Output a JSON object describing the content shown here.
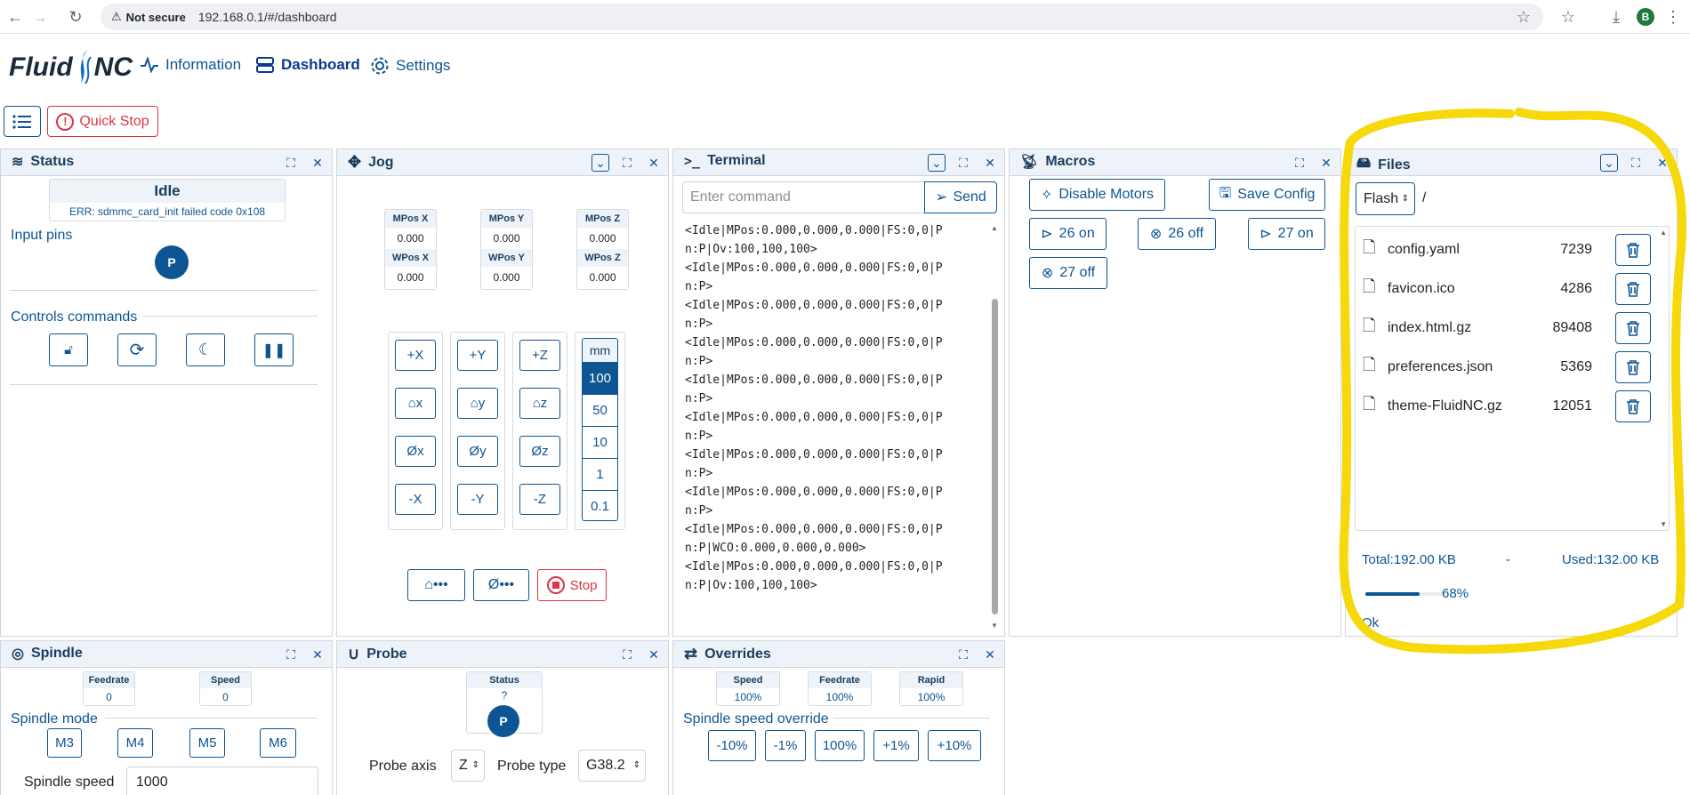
{
  "browser": {
    "security_label": "Not secure",
    "url": "192.168.0.1/#/dashboard",
    "profile_initial": "B"
  },
  "app": {
    "logo_left": "Fluid",
    "logo_right": "NC",
    "nav": {
      "information": "Information",
      "dashboard": "Dashboard",
      "settings": "Settings"
    },
    "quick_stop": "Quick Stop"
  },
  "status": {
    "title": "Status",
    "state": "Idle",
    "error": "ERR: sdmmc_card_init failed code 0x108",
    "input_pins_label": "Input pins",
    "pin": "P",
    "controls_label": "Controls commands"
  },
  "jog": {
    "title": "Jog",
    "positions": [
      {
        "mlabel": "MPos X",
        "mval": "0.000",
        "wlabel": "WPos X",
        "wval": "0.000"
      },
      {
        "mlabel": "MPos Y",
        "mval": "0.000",
        "wlabel": "WPos Y",
        "wval": "0.000"
      },
      {
        "mlabel": "MPos Z",
        "mval": "0.000",
        "wlabel": "WPos Z",
        "wval": "0.000"
      }
    ],
    "x_buttons": [
      "+X",
      "⌂x",
      "Øx",
      "-X"
    ],
    "y_buttons": [
      "+Y",
      "⌂y",
      "Øy",
      "-Y"
    ],
    "z_buttons": [
      "+Z",
      "⌂z",
      "Øz",
      "-Z"
    ],
    "unit": "mm",
    "steps": [
      "100",
      "50",
      "10",
      "1",
      "0.1"
    ],
    "selected_step": "100",
    "home_all": "⌂•••",
    "zero_all": "Ø•••",
    "stop": "Stop"
  },
  "terminal": {
    "title": "Terminal",
    "placeholder": "Enter command",
    "send": "Send",
    "lines": [
      "<Idle|MPos:0.000,0.000,0.000|FS:0,0|P",
      "n:P|Ov:100,100,100>",
      "<Idle|MPos:0.000,0.000,0.000|FS:0,0|P",
      "n:P>",
      "<Idle|MPos:0.000,0.000,0.000|FS:0,0|P",
      "n:P>",
      "<Idle|MPos:0.000,0.000,0.000|FS:0,0|P",
      "n:P>",
      "<Idle|MPos:0.000,0.000,0.000|FS:0,0|P",
      "n:P>",
      "<Idle|MPos:0.000,0.000,0.000|FS:0,0|P",
      "n:P>",
      "<Idle|MPos:0.000,0.000,0.000|FS:0,0|P",
      "n:P>",
      "<Idle|MPos:0.000,0.000,0.000|FS:0,0|P",
      "n:P>",
      "<Idle|MPos:0.000,0.000,0.000|FS:0,0|P",
      "n:P|WCO:0.000,0.000,0.000>",
      "<Idle|MPos:0.000,0.000,0.000|FS:0,0|P",
      "n:P|Ov:100,100,100>"
    ]
  },
  "macros": {
    "title": "Macros",
    "disable_motors": "Disable Motors",
    "save_config": "Save Config",
    "m26on": "26 on",
    "m26off": "26 off",
    "m27on": "27 on",
    "m27off": "27 off"
  },
  "files": {
    "title": "Files",
    "source": "Flash",
    "path": "/",
    "list": [
      {
        "name": "config.yaml",
        "size": "7239"
      },
      {
        "name": "favicon.ico",
        "size": "4286"
      },
      {
        "name": "index.html.gz",
        "size": "89408"
      },
      {
        "name": "preferences.json",
        "size": "5369"
      },
      {
        "name": "theme-FluidNC.gz",
        "size": "12051"
      }
    ],
    "total": "Total:192.00 KB",
    "sep": "-",
    "used": "Used:132.00 KB",
    "usage_percent": 68,
    "usage_label": "68%",
    "status": "Ok"
  },
  "spindle": {
    "title": "Spindle",
    "feedrate_label": "Feedrate",
    "feedrate": "0",
    "speed_label": "Speed",
    "speed": "0",
    "mode_label": "Spindle mode",
    "modes": [
      "M3",
      "M4",
      "M5",
      "M6"
    ],
    "speed_input_label": "Spindle speed",
    "speed_input": "1000"
  },
  "probe": {
    "title": "Probe",
    "status_label": "Status",
    "status_value": "?",
    "pin": "P",
    "axis_label": "Probe axis",
    "axis": "Z",
    "type_label": "Probe type",
    "type": "G38.2"
  },
  "overrides": {
    "title": "Overrides",
    "speed_label": "Speed",
    "speed": "100%",
    "feedrate_label": "Feedrate",
    "feedrate": "100%",
    "rapid_label": "Rapid",
    "rapid": "100%",
    "spindle_override_label": "Spindle speed override",
    "buttons": [
      "-10%",
      "-1%",
      "100%",
      "+1%",
      "+10%"
    ]
  },
  "colors": {
    "accent": "#0d5593",
    "danger": "#dc3545",
    "highlight": "#f5d90a"
  }
}
